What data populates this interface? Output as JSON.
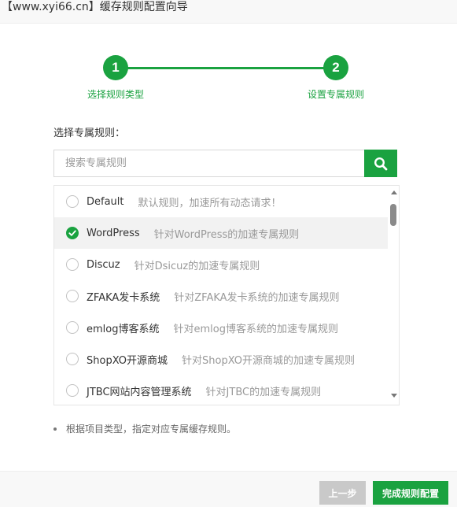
{
  "window": {
    "title": "【www.xyi66.cn】缓存规则配置向导"
  },
  "steps": [
    {
      "number": "1",
      "label": "选择规则类型"
    },
    {
      "number": "2",
      "label": "设置专属规则"
    }
  ],
  "rule_select": {
    "label": "选择专属规则：",
    "search_placeholder": "搜索专属规则",
    "search_value": ""
  },
  "rules": [
    {
      "name": "Default",
      "desc": "默认规则，加速所有动态请求！",
      "selected": false
    },
    {
      "name": "WordPress",
      "desc": "针对WordPress的加速专属规则",
      "selected": true
    },
    {
      "name": "Discuz",
      "desc": "针对Dsicuz的加速专属规则",
      "selected": false
    },
    {
      "name": "ZFAKA发卡系统",
      "desc": "针对ZFAKA发卡系统的加速专属规则",
      "selected": false
    },
    {
      "name": "emlog博客系统",
      "desc": "针对emlog博客系统的加速专属规则",
      "selected": false
    },
    {
      "name": "ShopXO开源商城",
      "desc": "针对ShopXO开源商城的加速专属规则",
      "selected": false
    },
    {
      "name": "JTBC网站内容管理系统",
      "desc": "针对JTBC的加速专属规则",
      "selected": false
    }
  ],
  "tip": "根据项目类型，指定对应专属缓存规则。",
  "footer": {
    "prev_label": "上一步",
    "finish_label": "完成规则配置"
  },
  "colors": {
    "accent": "#1aa240",
    "disabled_button": "#c9c9c9",
    "selected_row": "#f2f2f2"
  },
  "icons": {
    "search": "search-icon",
    "check": "check-icon"
  }
}
